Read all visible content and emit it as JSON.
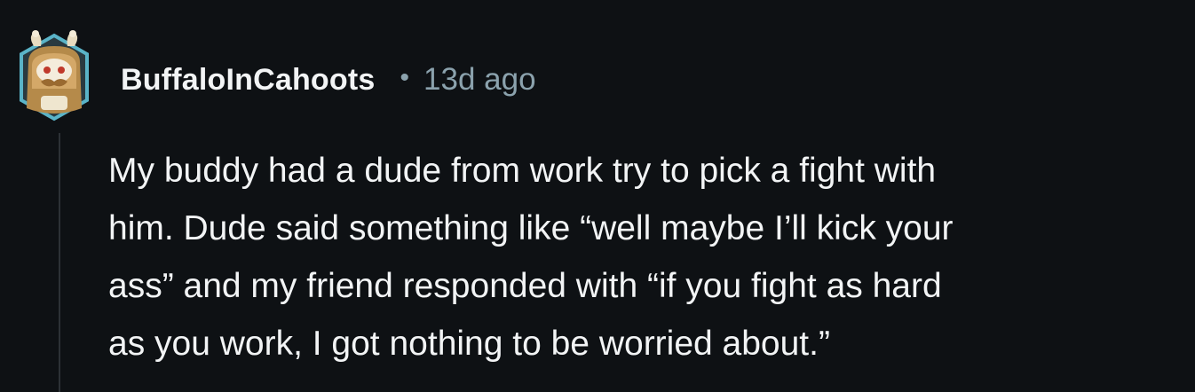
{
  "comment": {
    "author": "BuffaloInCahoots",
    "separator": "•",
    "time_ago": "13d ago",
    "avatar_icon": "snoo-avatar-icon",
    "body_lines": [
      "My buddy had a dude from work try to pick a fight with",
      "him. Dude said something like “well maybe I’ll kick your",
      "ass” and my friend responded with “if you fight as hard",
      "as you work, I got nothing to be worried about.”"
    ]
  },
  "colors": {
    "background": "#0e1114",
    "text": "#f2f4f5",
    "meta": "#8ba2ad",
    "avatar_frame": "#5ab4c8",
    "thread_line": "#2c3136"
  }
}
